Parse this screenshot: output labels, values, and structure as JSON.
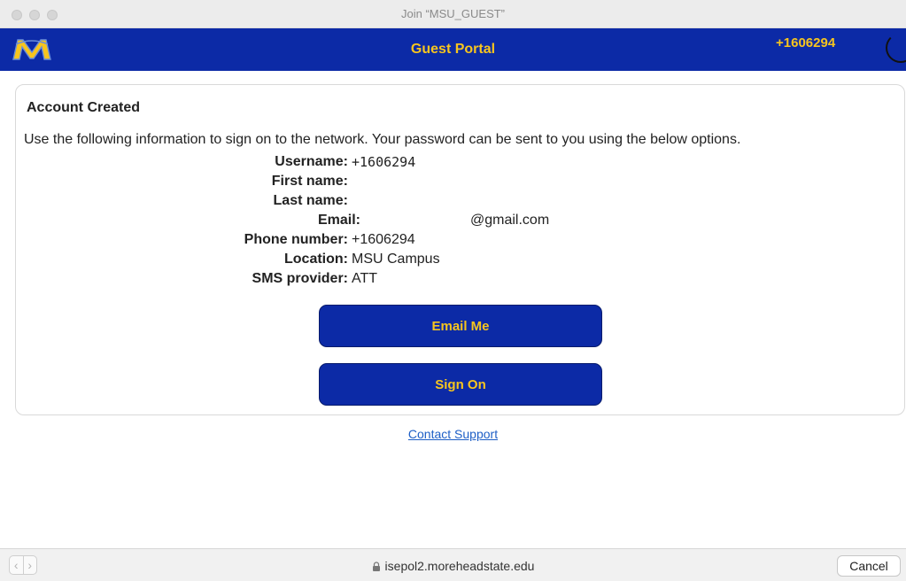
{
  "window": {
    "title": "Join “MSU_GUEST”"
  },
  "header": {
    "logo": "msu-m-logo",
    "title": "Guest Portal",
    "user": "+1606294",
    "colors": {
      "band": "#0c2aa6",
      "accent": "#f7c51e"
    }
  },
  "card": {
    "title": "Account Created",
    "description": "Use the following information to sign on to the network. Your password can be sent to you using the below options.",
    "fields": [
      {
        "label": "Username:",
        "value": "+1606294"
      },
      {
        "label": "First name:",
        "value": ""
      },
      {
        "label": "Last name:",
        "value": ""
      },
      {
        "label": "Email:",
        "value": "@gmail.com"
      },
      {
        "label": "Phone number:",
        "value": "+1606294"
      },
      {
        "label": "Location:",
        "value": "MSU Campus"
      },
      {
        "label": "SMS provider:",
        "value": "ATT"
      }
    ],
    "buttons": {
      "email_me": "Email Me",
      "sign_on": "Sign On"
    }
  },
  "footer": {
    "support_link": "Contact Support"
  },
  "bottom_bar": {
    "back_icon": "chevron-left-icon",
    "forward_icon": "chevron-right-icon",
    "url": "isepol2.moreheadstate.edu",
    "cancel_label": "Cancel"
  }
}
